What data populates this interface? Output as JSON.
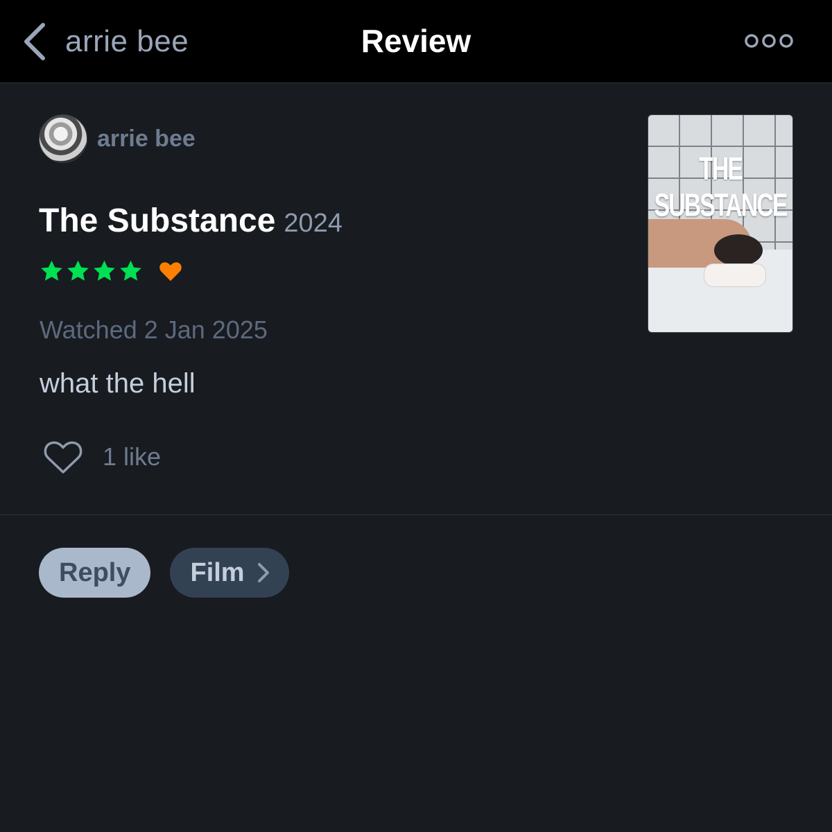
{
  "nav": {
    "back_label": "arrie bee",
    "title": "Review",
    "back_icon": "chevron-left-icon",
    "more_icon": "more-dots-icon"
  },
  "review": {
    "author": "arrie bee",
    "film_title": "The Substance",
    "film_year": "2024",
    "rating_stars": 4,
    "liked": true,
    "watched": "Watched 2 Jan 2025",
    "text": "what the hell",
    "like_count": "1 like",
    "poster_title": "THE SUBSTANCE"
  },
  "actions": {
    "reply_label": "Reply",
    "film_label": "Film"
  },
  "colors": {
    "background": "#181b20",
    "navbar": "#000000",
    "star": "#00e054",
    "heart": "#ff8000",
    "reply_pill": "#aab8cb",
    "film_pill": "#334253"
  }
}
